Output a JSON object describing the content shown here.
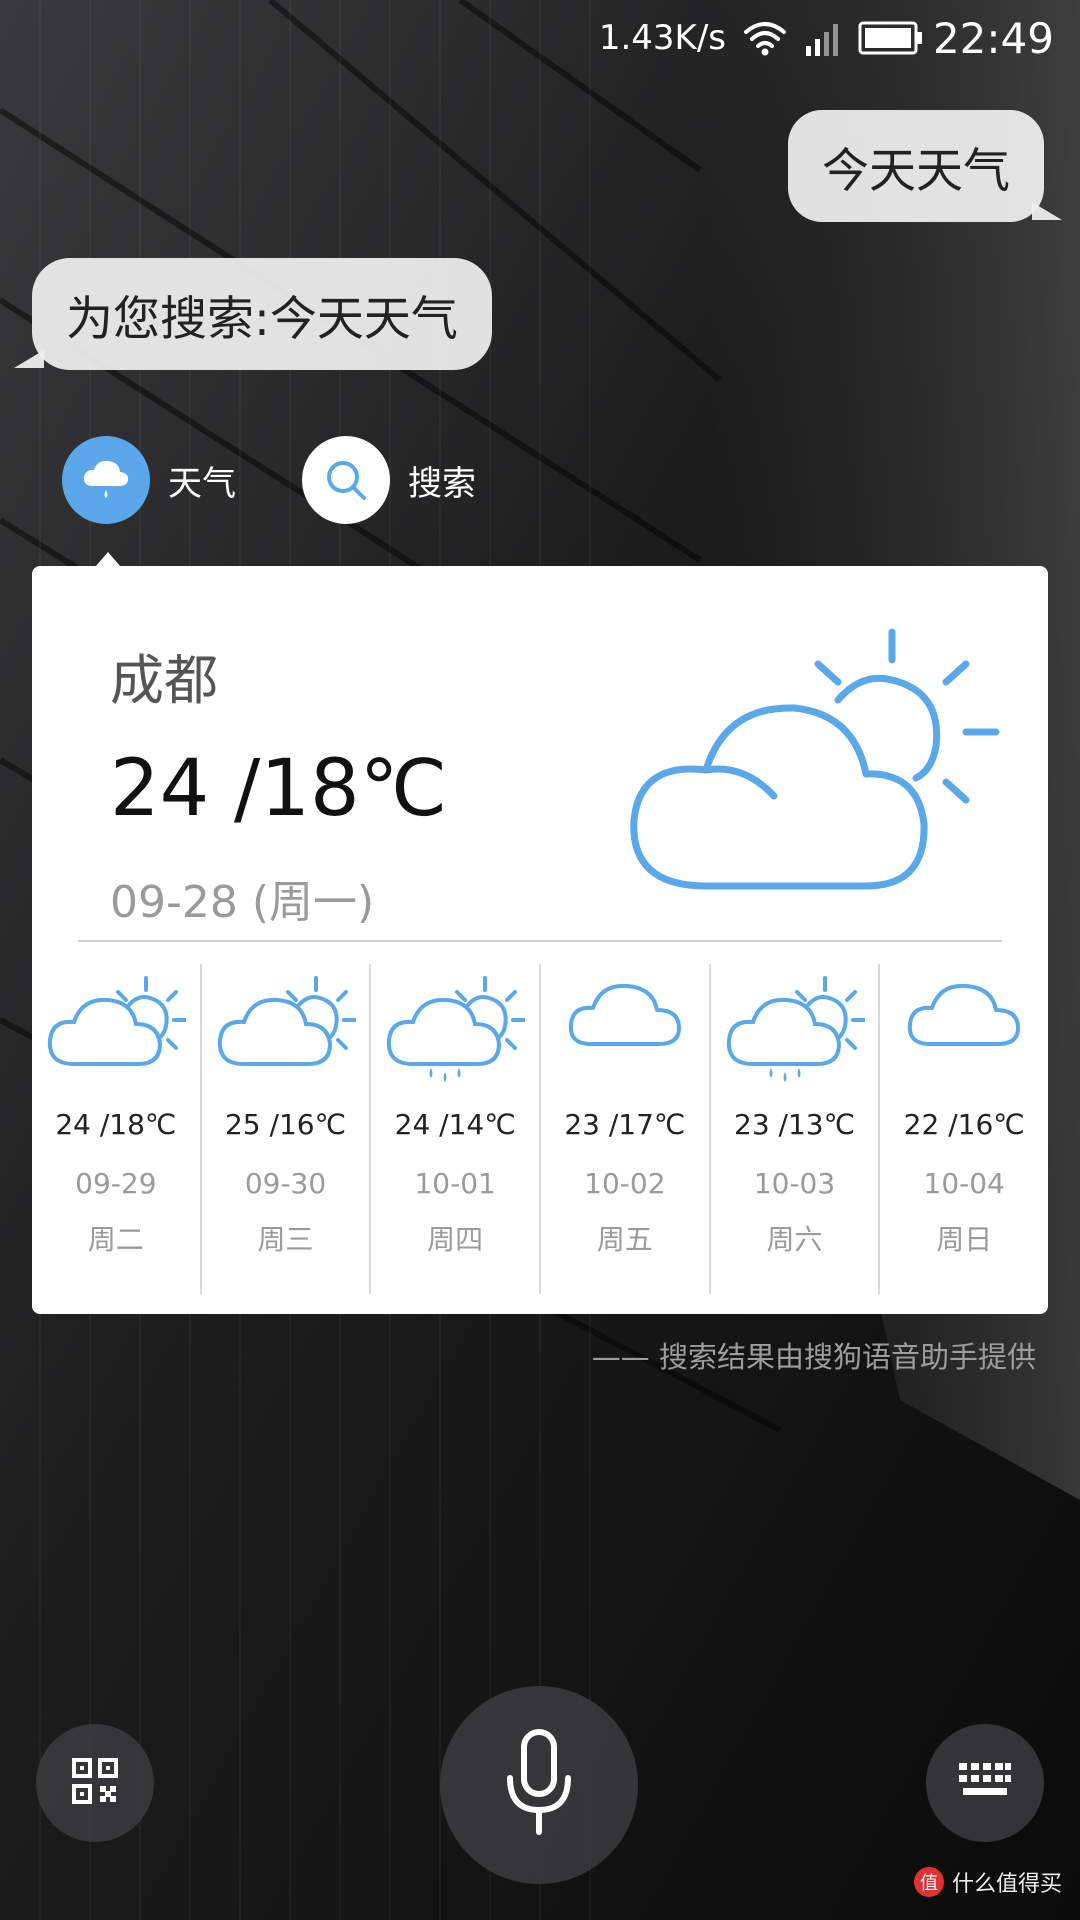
{
  "status_bar": {
    "net_speed": "1.43K/s",
    "time": "22:49"
  },
  "chat": {
    "user_query": "今天天气",
    "assistant_reply": "为您搜索:今天天气"
  },
  "categories": [
    {
      "label": "天气",
      "icon": "cloud-rain-icon",
      "selected": true
    },
    {
      "label": "搜索",
      "icon": "search-icon",
      "selected": false
    }
  ],
  "weather": {
    "city": "成都",
    "temperature": "24 /18℃",
    "date": "09-28 (周一)",
    "icon": "partly-cloudy-icon",
    "accent_color": "#5aa8ea",
    "forecast": [
      {
        "temp": "24 /18℃",
        "date": "09-29",
        "weekday": "周二",
        "icon": "partly-cloudy-icon"
      },
      {
        "temp": "25 /16℃",
        "date": "09-30",
        "weekday": "周三",
        "icon": "partly-cloudy-icon"
      },
      {
        "temp": "24 /14℃",
        "date": "10-01",
        "weekday": "周四",
        "icon": "sun-cloud-rain-icon"
      },
      {
        "temp": "23 /17℃",
        "date": "10-02",
        "weekday": "周五",
        "icon": "cloud-icon"
      },
      {
        "temp": "23 /13℃",
        "date": "10-03",
        "weekday": "周六",
        "icon": "sun-cloud-rain-icon"
      },
      {
        "temp": "22 /16℃",
        "date": "10-04",
        "weekday": "周日",
        "icon": "cloud-icon"
      }
    ]
  },
  "credit": "—— 搜索结果由搜狗语音助手提供",
  "controls": {
    "left": "qr-code-icon",
    "center": "microphone-icon",
    "right": "keyboard-icon"
  },
  "watermark": {
    "badge": "值",
    "text": "什么值得买"
  }
}
